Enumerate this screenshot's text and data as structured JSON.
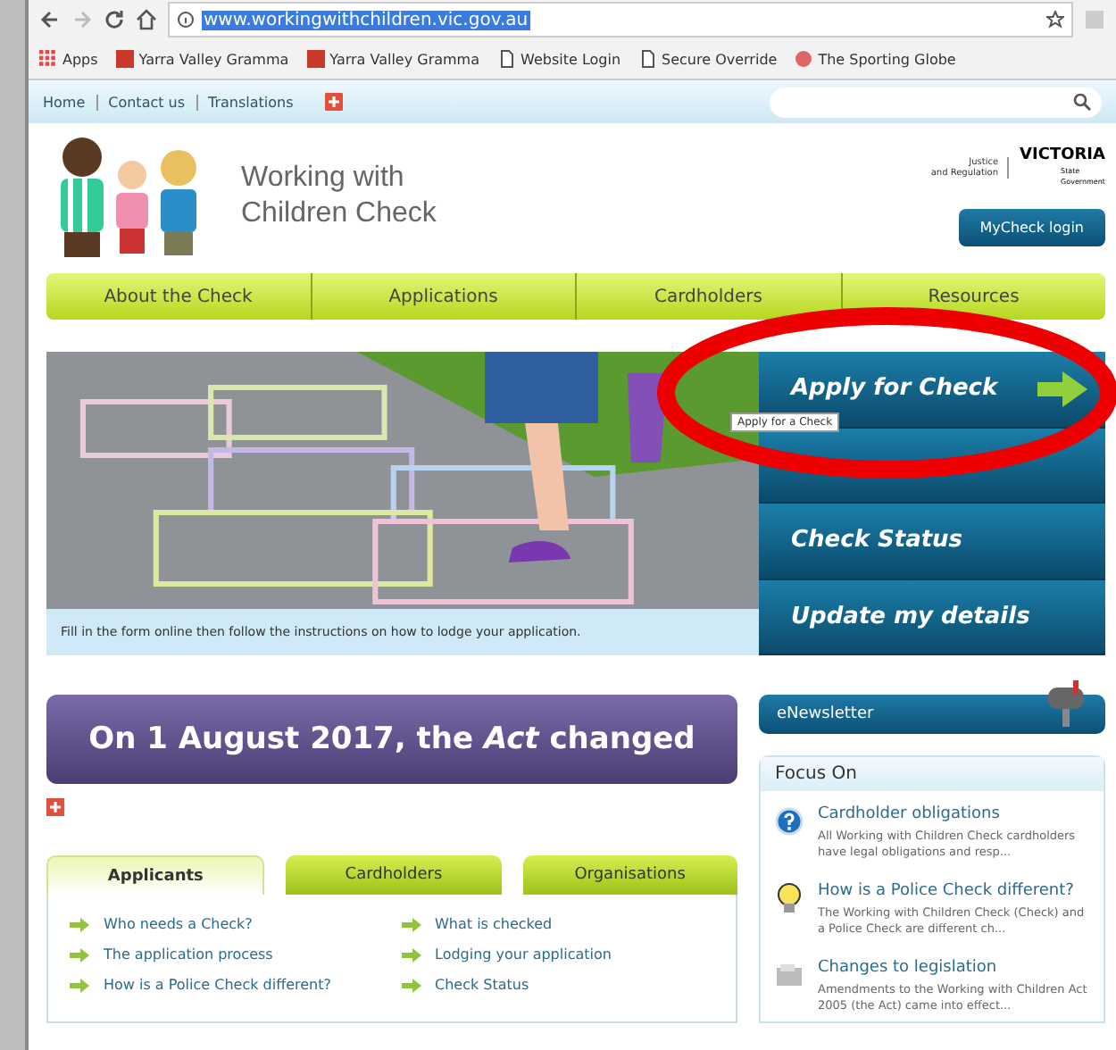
{
  "browser": {
    "url": "www.workingwithchildren.vic.gov.au",
    "bookmarks": [
      {
        "label": "Apps",
        "kind": "apps"
      },
      {
        "label": "Yarra Valley Gramma",
        "kind": "red"
      },
      {
        "label": "Yarra Valley Gramma",
        "kind": "red"
      },
      {
        "label": "Website Login",
        "kind": "page"
      },
      {
        "label": "Secure Override",
        "kind": "page"
      },
      {
        "label": "The Sporting Globe",
        "kind": "globe"
      }
    ]
  },
  "top_links": [
    "Home",
    "Contact us",
    "Translations"
  ],
  "header": {
    "title_lines": [
      "Working with",
      "Children Check"
    ],
    "logo": {
      "department": [
        "Justice",
        "and Regulation"
      ],
      "name": "VICTORIA",
      "sub": [
        "State",
        "Government"
      ]
    },
    "login_button": "MyCheck login"
  },
  "nav": [
    "About the Check",
    "Applications",
    "Cardholders",
    "Resources"
  ],
  "hero": {
    "caption": "Fill in the form online then follow the instructions on how to lodge your application.",
    "buttons": [
      {
        "label": "Apply for Check",
        "arrow": true
      },
      {
        "arrow": false
      },
      {
        "label": "Check Status",
        "arrow": false
      },
      {
        "label": "Update my details",
        "arrow": false
      }
    ],
    "tooltip": "Apply for a Check"
  },
  "banner": "On 1 August 2017, the *Act* changed",
  "tabs": [
    {
      "label": "Applicants",
      "selected": true
    },
    {
      "label": "Cardholders",
      "selected": false
    },
    {
      "label": "Organisations",
      "selected": false
    }
  ],
  "links": [
    "Who needs a Check?",
    "What is checked",
    "The application process",
    "Lodging your application",
    "How is a Police Check different?",
    "Check Status"
  ],
  "newsletter": "eNewsletter",
  "focus": {
    "title": "Focus On",
    "items": [
      {
        "kind": "question",
        "title": "Cardholder obligations",
        "text": "All Working with Children Check cardholders have legal obligations and resp..."
      },
      {
        "kind": "bulb",
        "title": "How is a Police Check different?",
        "text": "The Working with Children Check (Check) and a Police Check are different ch..."
      },
      {
        "kind": "document",
        "title": "Changes to legislation",
        "text": "Amendments to the Working with Children Act 2005 (the Act) came into effect..."
      }
    ]
  }
}
